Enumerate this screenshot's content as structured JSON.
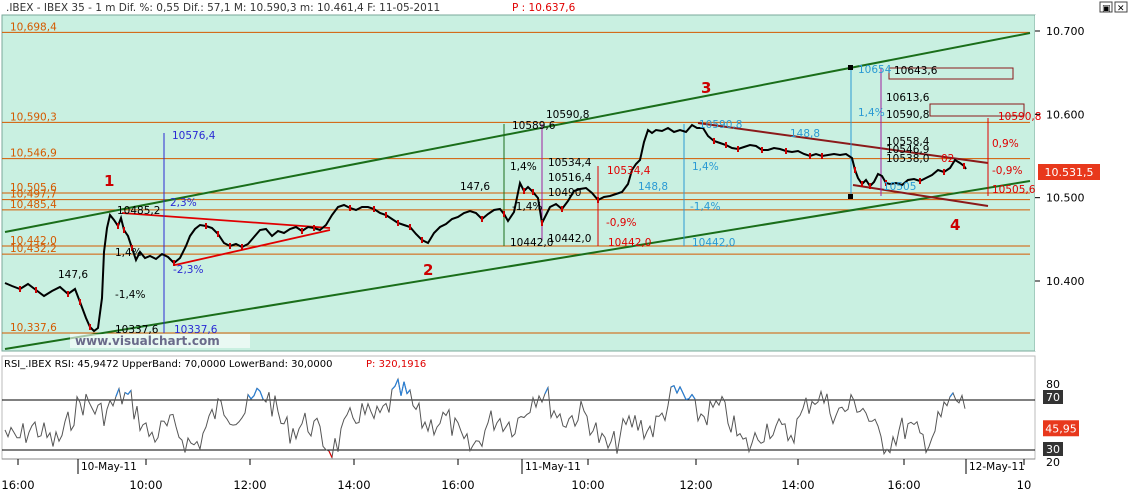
{
  "header": {
    "instrument": ".IBEX - IBEX 35 - 1 m Dif. %: 0,55 Dif.: 57,1 M: 10.590,3 m: 10.461,4 F: 11-05-2011",
    "last": "P : 10.637,6"
  },
  "window_controls": [
    "▣",
    "✕"
  ],
  "watermark": "www.visualchart.com",
  "colors": {
    "chart_bg": "#c9f0e1",
    "rsi_bg": "#ffffff",
    "price_line": "#000000",
    "down_tick": "#cc0000",
    "trend_green": "#1a6e1a",
    "orange_levels": "#d45a00",
    "maroon_channel": "#8b1a1a",
    "red_text": "#e00000",
    "blue_measure": "#2a7fd4",
    "label_price_box": "#e8381c"
  },
  "chart_data": [
    {
      "type": "line",
      "name": "IBEX 35 1 min",
      "title": "",
      "y_axis": {
        "ticks": [
          "10.700",
          "10.600",
          "10.500",
          "10.400"
        ],
        "tick_values": [
          10700,
          10600,
          10500,
          10400
        ],
        "ylim": [
          10325,
          10720
        ],
        "current_label": "10.531,5"
      },
      "x_axis": {
        "ticks": [
          "16:00",
          "10:00",
          "12:00",
          "14:00",
          "16:00",
          "10:00",
          "12:00",
          "14:00",
          "16:00",
          "10"
        ],
        "date_labels": [
          "10-May-11",
          "11-May-11",
          "12-May-11"
        ]
      },
      "levels": [
        {
          "label": "10,698,4",
          "value": 10698.4
        },
        {
          "label": "10,590,3",
          "value": 10590.3
        },
        {
          "label": "10,546,9",
          "value": 10546.9
        },
        {
          "label": "10,505,6",
          "value": 10505.6
        },
        {
          "label": "10,497,7",
          "value": 10497.7
        },
        {
          "label": "10,485,4",
          "value": 10485.4
        },
        {
          "label": "10,442,0",
          "value": 10442.0
        },
        {
          "label": "10,432,2",
          "value": 10432.2
        },
        {
          "label": "10,337,6",
          "value": 10337.6
        }
      ],
      "wave_labels": [
        "1",
        "2",
        "3",
        "4"
      ],
      "annotations": [
        "10576,4",
        "10337,6",
        "10337,6",
        "10485,2",
        "2,3%",
        "-2,3%",
        "147,6",
        "-1,4%",
        "1,4%",
        "10589,6",
        "10590,8",
        "10534,4",
        "10516,4",
        "10490",
        "1,4%",
        "147,6",
        "-1,4%",
        "10442,0",
        "10442,0",
        "10534,4",
        "-0,9%",
        "10442,0",
        "148,8",
        "10590,8",
        "148,8",
        "-1,4%",
        "10442,0",
        "1,4%",
        "10654",
        "10643,6",
        "10613,6",
        "10590,8",
        "10558,4",
        "10546,9",
        "10538,0",
        "10590,8",
        "0,9%",
        "-0,9%",
        "10505,6",
        "1,4%",
        "10505",
        "02"
      ]
    },
    {
      "type": "line",
      "name": "RSI",
      "title": "RSI_.IBEX RSI: 45,9472 UpperBand: 70,0000 LowerBand: 30,0000",
      "last": "P: 320,1916",
      "y_axis": {
        "ticks": [
          "80",
          "70",
          "30",
          "20"
        ],
        "tick_values": [
          80,
          70,
          30,
          20
        ],
        "current_label": "45,95",
        "upper_band": 70,
        "lower_band": 30
      }
    }
  ]
}
